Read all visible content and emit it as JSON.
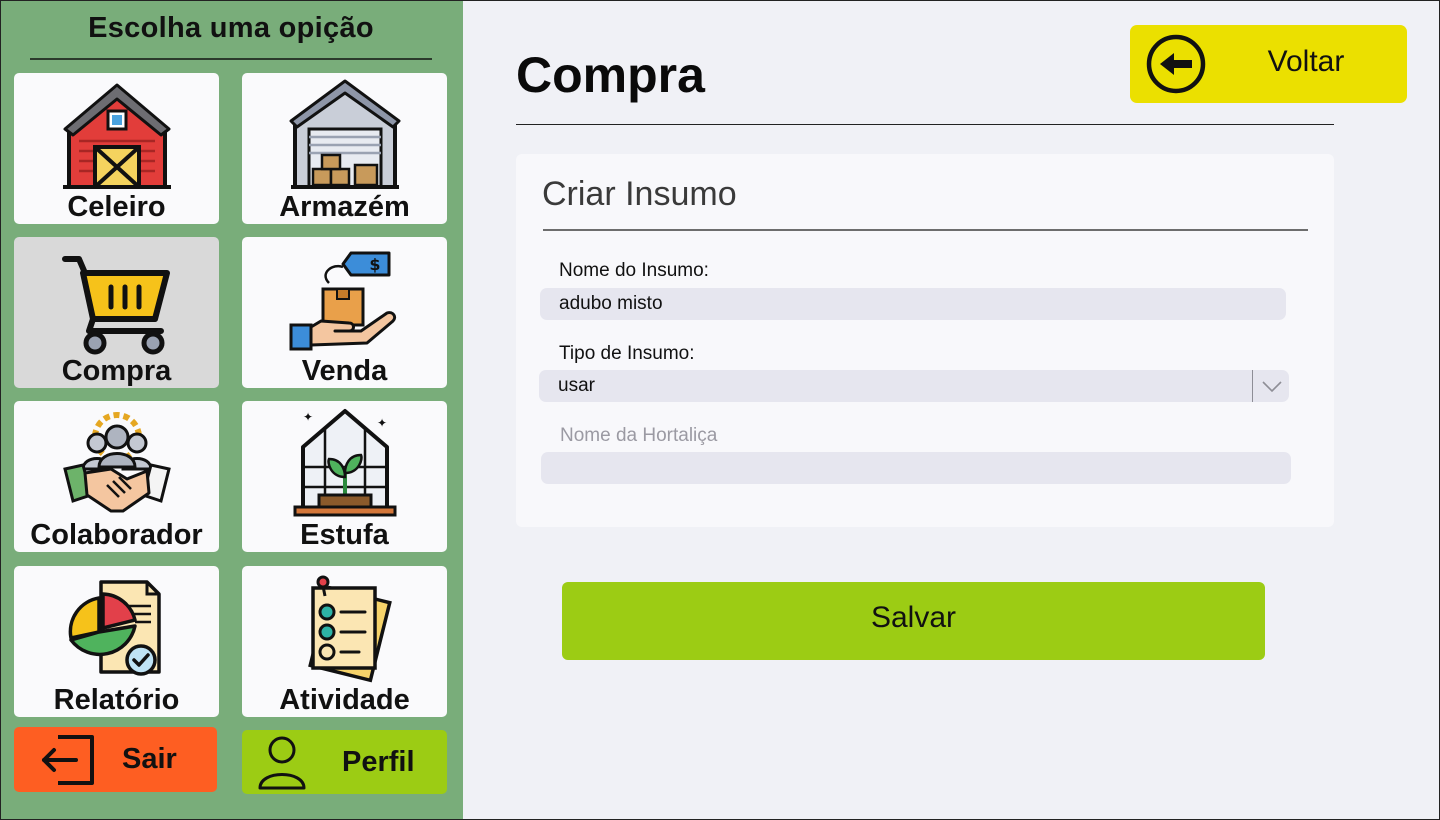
{
  "sidebar": {
    "title": "Escolha uma opição",
    "tiles": [
      {
        "label": "Celeiro",
        "icon": "barn-icon"
      },
      {
        "label": "Armazém",
        "icon": "warehouse-icon"
      },
      {
        "label": "Compra",
        "icon": "shopping-cart-icon",
        "active": true
      },
      {
        "label": "Venda",
        "icon": "sale-box-hand-icon"
      },
      {
        "label": "Colaborador",
        "icon": "team-handshake-icon"
      },
      {
        "label": "Estufa",
        "icon": "greenhouse-icon"
      },
      {
        "label": "Relatório",
        "icon": "report-chart-icon"
      },
      {
        "label": "Atividade",
        "icon": "checklist-icon"
      }
    ],
    "sair_label": "Sair",
    "perfil_label": "Perfil"
  },
  "header": {
    "title": "Compra",
    "back_label": "Voltar"
  },
  "form": {
    "title": "Criar Insumo",
    "nome_label": "Nome do Insumo:",
    "nome_value": "adubo misto",
    "tipo_label": "Tipo de Insumo:",
    "tipo_value": "usar",
    "hortalica_label": "Nome da Hortaliça",
    "hortalica_value": ""
  },
  "actions": {
    "save_label": "Salvar"
  },
  "colors": {
    "sidebar": "#79ad7a",
    "back_button": "#ebe000",
    "save_button": "#9ccc14",
    "logout_button": "#fe5e22",
    "profile_button": "#9ccc14",
    "active_tile": "#d9d9d9"
  }
}
